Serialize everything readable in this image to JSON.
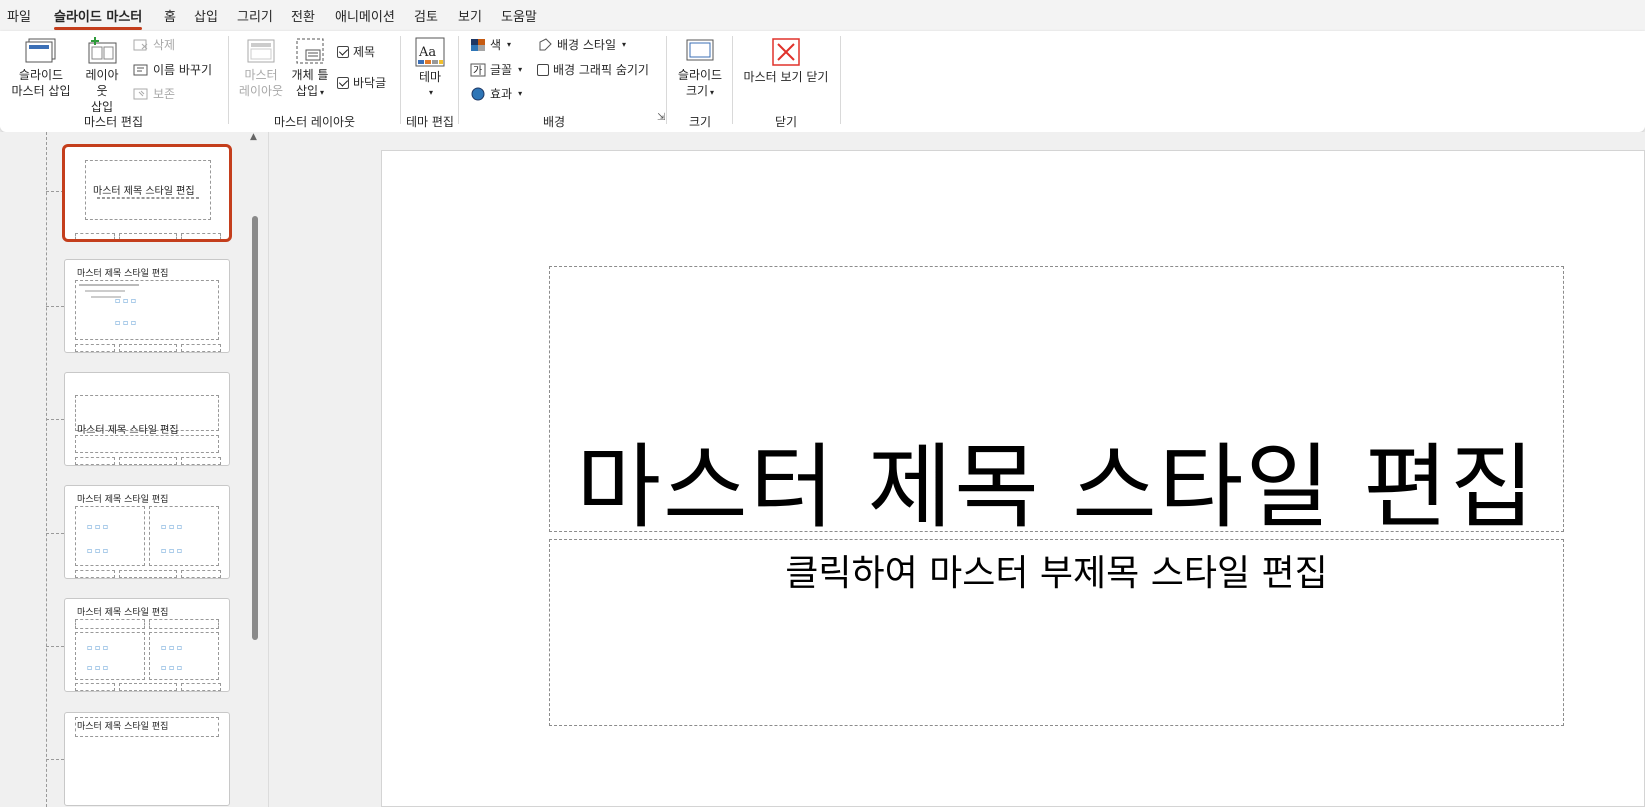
{
  "menu": {
    "tabs": [
      "파일",
      "슬라이드 마스터",
      "홈",
      "삽입",
      "그리기",
      "전환",
      "애니메이션",
      "검토",
      "보기",
      "도움말"
    ],
    "active_tab": "슬라이드 마스터"
  },
  "ribbon": {
    "master_edit": {
      "insert_master_line1": "슬라이드",
      "insert_master_line2": "마스터 삽입",
      "insert_layout_line1": "레이아웃",
      "insert_layout_line2": "삽입",
      "delete": "삭제",
      "rename": "이름 바꾸기",
      "preserve": "보존",
      "label": "마스터 편집"
    },
    "master_layout": {
      "master_layout_line1": "마스터",
      "master_layout_line2": "레이아웃",
      "insert_placeholder_line1": "개체 틀",
      "insert_placeholder_line2": "삽입",
      "title_check": "제목",
      "footer_check": "바닥글",
      "label": "마스터 레이아웃"
    },
    "edit_theme": {
      "theme": "테마",
      "label": "테마 편집"
    },
    "background": {
      "colors": "색",
      "fonts": "글꼴",
      "effects": "효과",
      "background_styles": "배경 스타일",
      "hide_background_graphics": "배경 그래픽 숨기기",
      "label": "배경"
    },
    "size": {
      "slide_size_line1": "슬라이드",
      "slide_size_line2": "크기",
      "label": "크기"
    },
    "close": {
      "close_master_view": "마스터 보기 닫기",
      "label": "닫기"
    }
  },
  "thumbnails": {
    "title_text": "마스터 제목 스타일 편집"
  },
  "slide": {
    "title": "마스터 제목 스타일 편집",
    "subtitle": "클릭하여 마스터 부제목 스타일 편집"
  },
  "colors": {
    "accent": "#c43e1c",
    "close_icon": "#e0322b"
  }
}
